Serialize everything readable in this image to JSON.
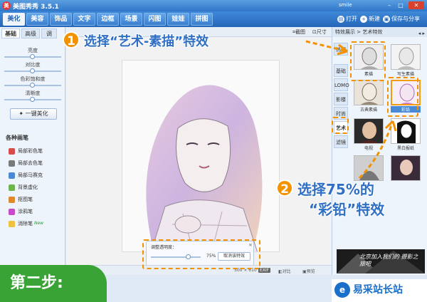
{
  "app": {
    "title": "美图秀秀 3.5.1",
    "icon": "美",
    "user": "smile"
  },
  "main_tabs": [
    "美化",
    "美容",
    "饰品",
    "文字",
    "边框",
    "场景",
    "闪图",
    "娃娃",
    "拼图"
  ],
  "top_actions": {
    "open": "打开",
    "new": "新建",
    "save": "保存与分享"
  },
  "left_panel": {
    "sub_tabs": [
      "基础",
      "高级",
      "调"
    ],
    "sliders": [
      {
        "label": "亮度",
        "value": 0.5
      },
      {
        "label": "对比度",
        "value": 0.5
      },
      {
        "label": "色彩饱和度",
        "value": 0.5
      },
      {
        "label": "清晰度",
        "value": 0.5
      }
    ],
    "one_click_label": "一键美化",
    "brush_title": "各种画笔",
    "brushes": [
      {
        "label": "局部彩色笔",
        "color": "#d94b4b",
        "new": ""
      },
      {
        "label": "局部去色笔",
        "color": "#7a7a7a",
        "new": ""
      },
      {
        "label": "局部马赛克",
        "color": "#4a8ad4",
        "new": ""
      },
      {
        "label": "背景虚化",
        "color": "#6bb54a",
        "new": ""
      },
      {
        "label": "抠图笔",
        "color": "#e08a2a",
        "new": ""
      },
      {
        "label": "涂鸦笔",
        "color": "#c94ac9",
        "new": ""
      },
      {
        "label": "消除笔",
        "color": "#f0c040",
        "new": "New"
      }
    ]
  },
  "canvas": {
    "toolbar": {
      "crop": "截图",
      "size": "尺寸"
    },
    "opacity_panel": {
      "label": "调整透明度：",
      "value": "75%",
      "level": 0.75,
      "cancel": "取消该特效",
      "close": "×"
    },
    "status": {
      "dims": "500 × 610",
      "exif": "EXIF",
      "compare": "对比",
      "preview": "预览"
    }
  },
  "right_panel": {
    "header": "特效展示 > 艺术特效",
    "vtabs": [
      "热门",
      "基础",
      "LOMO",
      "影楼",
      "时尚",
      "艺术",
      "滤镜"
    ],
    "thumbs": [
      {
        "caption": "素描"
      },
      {
        "caption": "写生素描"
      },
      {
        "caption": "古典素描"
      },
      {
        "caption": "彩铅"
      },
      {
        "caption": "电视"
      },
      {
        "caption": "黑白报纸"
      }
    ],
    "ad_text": "北京加入我们的 摄影之旅吧"
  },
  "annotations": {
    "step1_num": "1",
    "step1_text": "选择“艺术-素描”特效",
    "step2_num": "2",
    "step2_line1": "选择75%的",
    "step2_line2": "“彩铅”特效",
    "step_badge": "第二步:",
    "accent": "#f39200",
    "callout_color": "#2f6fc4"
  },
  "watermark": {
    "text": "易采站长站"
  }
}
